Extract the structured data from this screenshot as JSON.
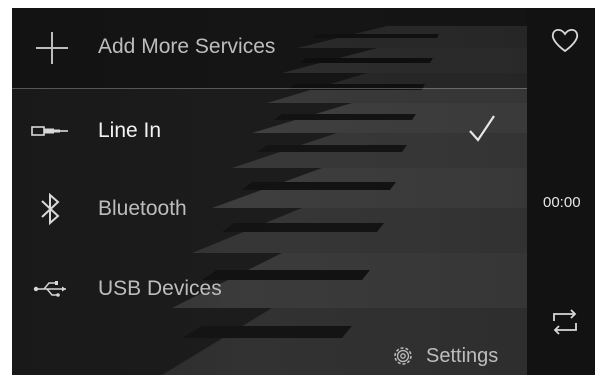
{
  "menu": {
    "add_services_label": "Add More Services",
    "items": [
      {
        "label": "Line In",
        "icon": "line-in-icon",
        "selected": true
      },
      {
        "label": "Bluetooth",
        "icon": "bluetooth-icon",
        "selected": false
      },
      {
        "label": "USB Devices",
        "icon": "usb-icon",
        "selected": false
      }
    ],
    "settings_label": "Settings"
  },
  "player": {
    "elapsed_time": "00:00"
  },
  "colors": {
    "text_primary": "#f2f2f2",
    "text_secondary": "#bdbdbd",
    "background": "#151515"
  }
}
